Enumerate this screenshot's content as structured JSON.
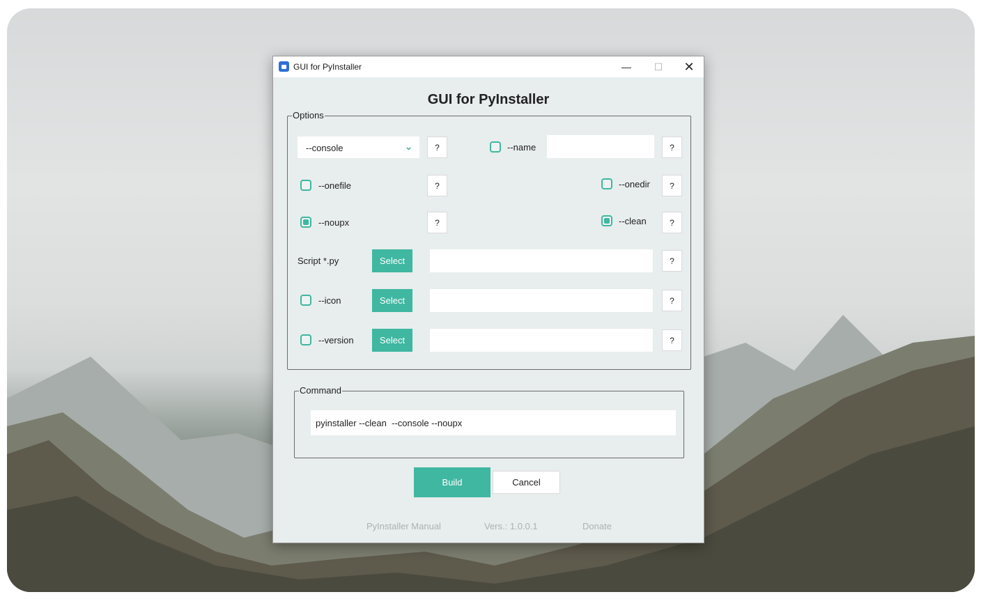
{
  "window": {
    "title": "GUI for PyInstaller",
    "minimize_glyph": "—",
    "maximize_glyph": "☐",
    "close_glyph": "✕"
  },
  "heading": "GUI for PyInstaller",
  "options": {
    "group_title": "Options",
    "console_select": {
      "value": "--console",
      "chevron": "⌄"
    },
    "help_label": "?",
    "name_label": "--name",
    "name_value": "",
    "onefile_label": "--onefile",
    "onefile_checked": false,
    "onedir_label": "--onedir",
    "onedir_checked": false,
    "noupx_label": "--noupx",
    "noupx_checked": true,
    "clean_label": "--clean",
    "clean_checked": true,
    "name_checked": false,
    "script_label": "Script *.py",
    "icon_label": "--icon",
    "icon_checked": false,
    "version_label": "--version",
    "version_checked": false,
    "select_label": "Select",
    "script_value": "",
    "icon_value": "",
    "version_value": ""
  },
  "command": {
    "group_title": "Command",
    "value": "pyinstaller --clean  --console --noupx"
  },
  "actions": {
    "build_label": "Build",
    "cancel_label": "Cancel"
  },
  "footer": {
    "manual": "PyInstaller Manual",
    "version": "Vers.: 1.0.0.1",
    "donate": "Donate"
  },
  "colors": {
    "accent": "#3fb7a1",
    "window_bg": "#e8eded",
    "footer_text": "#a9b4b3"
  }
}
